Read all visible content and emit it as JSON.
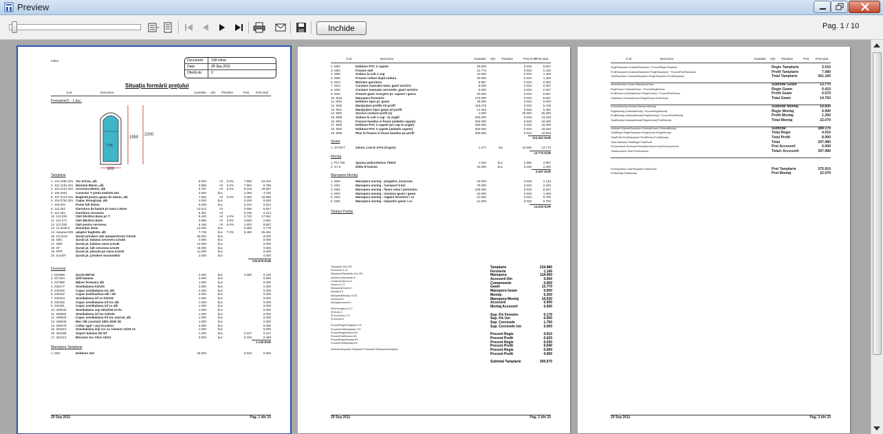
{
  "window": {
    "title": "Preview"
  },
  "toolbar": {
    "include_label": "Inchide",
    "page_indicator": "Pag. 1 / 10",
    "zoom_level": 0.03
  },
  "page1": {
    "user": "mihai",
    "info": {
      "doc_label": "Document:",
      "doc_value": "158 mihai",
      "date_label": "Data:",
      "date_value": "28 Sep 2011",
      "ofer_label": "Ofertă de:",
      "ofer_value": "0"
    },
    "title": "Situația formării prețului",
    "headers": {
      "cod": "Cod",
      "den": "Denumire",
      "cant": "Cantitate",
      "um": "UM",
      "pierd": "Pierdere",
      "pret": "Preț",
      "total": "Preț total"
    },
    "product": "Fereastra01 - 1 buc.",
    "drawing": {
      "w": "900",
      "h_out": "2200",
      "h_in": "1950",
      "label": "7.06"
    },
    "sec_templates": "Tamplarie",
    "templates": [
      [
        "1. 101.2081.001",
        "Toc 67mm, alb",
        "6.930",
        "ml",
        "6.0%",
        "7.850",
        "54.404"
      ],
      [
        "2. 101.2181.001",
        "Montant 85mm, alb",
        "0.855",
        "ml",
        "5.0%",
        "7.950",
        "6.795"
      ],
      [
        "3. 103.2121.001",
        "Cercevea 80mm, alb",
        "5.797",
        "ml",
        "6.0%",
        "8.100",
        "46.957"
      ],
      [
        "4. 106.2001",
        "Conector T pt102.218/102.241",
        "2.000",
        "buc",
        "",
        "2.050",
        "4.100"
      ],
      [
        "5. 107.2141.001",
        "Baghetă pentru geam de 24mm, alb",
        "7.593",
        "ml",
        "5.0%",
        "2.050",
        "15.566"
      ],
      [
        "6. 109.0761.001",
        "Capac drenaj/cap, alb",
        "4.000",
        "buc",
        "",
        "0.150",
        "0.600"
      ],
      [
        "7. 109.201",
        "Punte falt 32mm",
        "6.000",
        "buc",
        "",
        "0.104",
        "0.624"
      ],
      [
        "8. 112.253",
        "Garnitura de batant pt rama 2.5mm",
        "12.612",
        "ml",
        "",
        "0.550",
        "6.937"
      ],
      [
        "9. 112.254",
        "Garnitura cercevea",
        "5.381",
        "ml",
        "",
        "0.430",
        "2.314"
      ],
      [
        "10. 113.025",
        "Oțel 30x30x1.5mm pt. T",
        "6.420",
        "ml",
        "5.0%",
        "2.740",
        "17.591"
      ],
      [
        "11. 113.271",
        "Oțel 38x30x1.5mm",
        "0.855",
        "ml",
        "5.0%",
        "3.500",
        "2.991"
      ],
      [
        "12. 113.292",
        "Oțel pentru cercevea",
        "5.188",
        "ml",
        "5.0%",
        "1.900",
        "9.857"
      ],
      [
        "13. 14.2026.5",
        "Distanțier 5mm",
        "12.000",
        "buc",
        "",
        "0.065",
        "0.779"
      ],
      [
        "14. zaaaaaA001",
        "adaptor baghetă, alb",
        "7.738",
        "buc",
        "7.0%",
        "8.460",
        "65.461"
      ],
      [
        "15. S3.9x16",
        "Șurub prindere oțel autoperforant 3.9x16",
        "28.000",
        "buc",
        "",
        "",
        "0.000"
      ],
      [
        "16. SBC",
        "Șurub pt. balama cercevea 4.0x45",
        "4.000",
        "buc",
        "",
        "",
        "0.000"
      ],
      [
        "17. SBR",
        "Șurub pt. balama rama 4.0x45",
        "12.000",
        "buc",
        "",
        "",
        "0.000"
      ],
      [
        "18. SF",
        "Șurub pt. falt cercevea 4.0x25",
        "18.000",
        "buc",
        "",
        "",
        "0.000"
      ],
      [
        "19. SPR",
        "Șurub pt. placuta pe rama 4.0x25",
        "11.000",
        "buc",
        "",
        "",
        "0.000"
      ],
      [
        "20. SurubT",
        "Șurub pt. prindere montantilor",
        "2.000",
        "buc",
        "",
        "",
        "0.000"
      ]
    ],
    "templates_total": "234.976 EUR",
    "sec_feronerie": "Feronerie",
    "feronerie": [
      [
        "1. 002988",
        "Șurub M5*45",
        "2.000",
        "buc",
        "",
        "0.080",
        "0.160"
      ],
      [
        "2. 227364",
        "Știft balama",
        "2.000",
        "buc",
        "",
        "",
        "0.000"
      ],
      [
        "3. 227888",
        "Mâner fereastra alb",
        "1.000",
        "buc",
        "",
        "",
        "0.000"
      ],
      [
        "4. 230177",
        "Semibalama K3/100",
        "2.000",
        "buc",
        "",
        "",
        "0.000"
      ],
      [
        "5. 230205",
        "Capac semibalama toc alb",
        "2.000",
        "buc",
        "",
        "",
        "0.000"
      ],
      [
        "6. 230252",
        "Capac bratfoarfeca alb / SD",
        "2.000",
        "buc",
        "",
        "",
        "0.000"
      ],
      [
        "7. 230343",
        "Semibalama inf cv K3/100",
        "1.000",
        "buc",
        "",
        "",
        "0.000"
      ],
      [
        "8. 230426",
        "Capac semibalama inf toc alb",
        "1.000",
        "buc",
        "",
        "",
        "0.000"
      ],
      [
        "9. 230491",
        "Capac semibalama inf cv alb",
        "1.000",
        "buc",
        "",
        "",
        "0.000"
      ],
      [
        "10. 230640",
        "Semibalama sup SD12/20-13 Dr.",
        "1.000",
        "buc",
        "",
        "",
        "0.000"
      ],
      [
        "11. 258590",
        "Semibalama inf toc K3/100",
        "1.000",
        "buc",
        "",
        "",
        "0.000"
      ],
      [
        "12. 258926",
        "Capac semibalama inf toc marcat, alb",
        "1.000",
        "buc",
        "",
        "",
        "0.000"
      ],
      [
        "13. 259849",
        "Mec OB constant 1801-2000 2E",
        "1.000",
        "buc",
        "",
        "",
        "0.000"
      ],
      [
        "14. 260275",
        "Colțar cgal + pat incuietor",
        "2.000",
        "buc",
        "",
        "",
        "0.000"
      ],
      [
        "15. 264015",
        "Semibalama mijl cor cu rulment 12/20-13",
        "1.000",
        "buc",
        "",
        "",
        "0.000"
      ],
      [
        "16. 331488",
        "Suport balama SD NT",
        "1.000",
        "buc",
        "",
        "0.317",
        "0.317"
      ],
      [
        "17. 352213",
        "Blocator toc Vdcn AD13",
        "3.000",
        "buc",
        "",
        "0.156",
        "0.468"
      ]
    ],
    "feronerie_total": "1.145 EUR",
    "sec_manopera": "Manopera Tamplarie",
    "manopera": [
      [
        "1. M01",
        "Debitare otel",
        "18.000",
        "",
        "",
        "0.033",
        "0.600"
      ]
    ],
    "footer_date": "29 Sep 2011",
    "footer_page": "Pag. 1 din 10"
  },
  "page2": {
    "headers": {
      "cod": "Cod",
      "den": "Denumire",
      "cant": "Cantitate",
      "um": "UM",
      "pierd": "Pierdere",
      "pret": "Preț EUR",
      "total": "Preț total"
    },
    "manopera": [
      [
        "2. M03",
        "Debitare PVC 2 capete",
        "20.000",
        "",
        "",
        "0.033",
        "0.667"
      ],
      [
        "3. M04",
        "Frezare otel",
        "12.773",
        "",
        "",
        "0.033",
        "0.426"
      ],
      [
        "4. M05",
        "Sudura la colt 1 cap",
        "42.000",
        "",
        "",
        "0.033",
        "1.400"
      ],
      [
        "5. M09",
        "Frezare colturi după sudura",
        "40.000",
        "",
        "",
        "0.033",
        "1.333"
      ],
      [
        "6. M13",
        "Montare garnitura",
        "8.997",
        "",
        "",
        "0.033",
        "0.300"
      ],
      [
        "7. M14",
        "Curatare manuala rame, gauri aerisire",
        "8.000",
        "",
        "",
        "0.033",
        "0.267"
      ],
      [
        "8. M15",
        "Curatare manuala cercevele, gauri aerisire",
        "8.000",
        "",
        "",
        "0.033",
        "0.267"
      ],
      [
        "9. M16",
        "Frezare gauri scurgere pt. capace / gaura",
        "20.000",
        "",
        "",
        "0.033",
        "0.667"
      ],
      [
        "10. M18",
        "Manopera feronerie",
        "170.000",
        "",
        "",
        "0.033",
        "5.667"
      ],
      [
        "11. M19",
        "Debitare sipci pt. geam",
        "18.000",
        "",
        "",
        "0.033",
        "0.600"
      ],
      [
        "12. M30",
        "Manipulare profile ml profil",
        "153.278",
        "",
        "",
        "0.033",
        "5.109"
      ],
      [
        "13. M31",
        "Manipulare sipci geam ml profil",
        "14.463",
        "",
        "",
        "0.033",
        "0.482"
      ],
      [
        "14. M50",
        "Servicii curbare profil (1)",
        "1.000",
        "",
        "",
        "25.000",
        "25.000"
      ],
      [
        "15. M89",
        "Sudura la colt 1 cap - la unghi",
        "400.000",
        "",
        "",
        "0.033",
        "13.333"
      ],
      [
        "16. M91",
        "Frezare bandou si fixare (ambele capete)",
        "450.000",
        "",
        "",
        "0.033",
        "15.000"
      ],
      [
        "17. M93",
        "Debitare PVC 2 capete (un cap la unghi)",
        "450.000",
        "",
        "",
        "0.033",
        "15.000"
      ],
      [
        "18. M94",
        "Debitare PVC 2 capete (ambele capete)",
        "550.000",
        "",
        "",
        "0.033",
        "18.333"
      ],
      [
        "19. M95",
        "Plus fa frezare si fixare bandou pe profil",
        "300.000",
        "",
        "",
        "0.033",
        "10.000"
      ]
    ],
    "manopera_total": "114.451 EUR",
    "sec_geam": "Geam",
    "geam": [
      [
        "1. GT0077",
        "24mm, Low-E 4+F4 (Argon)",
        "1.377",
        "mp",
        "",
        "10.000",
        "13.773"
      ]
    ],
    "geam_total": "13.773 EUR",
    "sec_montaj": "Montaj",
    "montaj": [
      [
        "1. PU-750",
        "Spuma poliuretanica 750ml",
        "1.033",
        "buc",
        "",
        "2.900",
        "2.997"
      ],
      [
        "2. S7.5",
        "Diblu 8*112mm",
        "10.000",
        "buc",
        "",
        "0.230",
        "2.300"
      ]
    ],
    "montaj_total": "5.297 EUR",
    "sec_man_montaj": "Manopera Montaj",
    "man_montaj": [
      [
        "1. M20",
        "Manopera montaj - pregatire, incarcare",
        "34.000",
        "",
        "",
        "0.033",
        "1.133"
      ],
      [
        "2. M21",
        "Manopera montaj - transport 5 km",
        "70.000",
        "",
        "",
        "0.033",
        "2.333"
      ],
      [
        "3. M22",
        "Manopera montaj - fixare rama / perimetru",
        "248.000",
        "",
        "",
        "0.033",
        "8.267"
      ],
      [
        "4. M23",
        "Manopera montaj - montare geam / geam",
        "42.000",
        "",
        "",
        "0.033",
        "1.400"
      ],
      [
        "5. M24",
        "Manopera montaj - reglare feronerie / cv",
        "21.000",
        "",
        "",
        "0.033",
        "0.700"
      ],
      [
        "6. M25",
        "Manopera montaj - impartire geam / cv",
        "21.000",
        "",
        "",
        "0.033",
        "0.700"
      ]
    ],
    "man_montaj_total": "14.533 EUR",
    "sec_totaluri": "Totaluri Poziție",
    "formulas": [
      "Tamplarie=234.976",
      "Feronerie=1.14",
      "ManoperaTamplarie=114.451",
      "AccDinComponente=0",
      "ComponenteLoc=0",
      "Geam=13.77",
      "ManoperaGeam=0",
      "Montaj=5.3",
      "ManoperaMontaj=14.53",
      "Accesorii=0",
      "MontajAccesorii=0",
      "SFixFereastra=0.17",
      "SFixUsi=0",
      "SCercevele=1.75",
      "SCercUsi=0",
      "ProcentRegieTamplarie=1%",
      "ProcentProfitTamplarie=2%",
      "ProcentRegieGeam=3%",
      "ProcentProfitGeam=4%",
      "ProcentRegieMontaj=5%",
      "ProcentProfitMontaj=6%",
      "SubtotalTamplarie=Tamplarie+Feronerie+ManoperaTamplarie"
    ],
    "summary_group1": [
      [
        "Tamplarie",
        "234.980"
      ],
      [
        "Feronerie",
        "1.140"
      ],
      [
        "Manopera",
        "114.450"
      ],
      [
        "Accesorii Din",
        "0.000"
      ],
      [
        "Componente",
        "0.000"
      ],
      [
        "Geam",
        "13.770"
      ],
      [
        "Manopera Geam",
        "0.000"
      ],
      [
        "Montaj",
        "5.300"
      ],
      [
        "Manopera Montaj",
        "14.530"
      ],
      [
        "Accesorii",
        "0.000"
      ],
      [
        "Montaj Accesorii",
        "0.000"
      ]
    ],
    "summary_group2": [
      [
        "Sup. Fix Ferestre",
        "0.170"
      ],
      [
        "Sup. Fix Usi",
        "0.000"
      ],
      [
        "Sup. Cercevele",
        "1.750"
      ],
      [
        "Sup. Cercevele Usi",
        "0.000"
      ]
    ],
    "summary_group3": [
      [
        "Procent Regie",
        "0.010"
      ],
      [
        "Procent Profit",
        "0.020"
      ],
      [
        "Procent Regie",
        "0.030"
      ],
      [
        "Procent Profit",
        "0.040"
      ],
      [
        "Procent Regie",
        "0.050"
      ],
      [
        "Procent Profit",
        "0.060"
      ]
    ],
    "subtotal_tamplarie": [
      "Subtotal Tamplarie",
      "350.570"
    ],
    "footer_date": "29 Sep 2011",
    "footer_page": "Pag. 2 din 10"
  },
  "page3": {
    "headers": {
      "cod": "Cod",
      "den": "Denumire",
      "cant": "Cantitate",
      "um": "UM",
      "pierd": "Pierdere",
      "pret": "Preț",
      "total": "Preț total"
    },
    "rows": [
      [
        "RegieTamplarie=SubtotalTamplarie * ProcentRegieTamplarie",
        "Regie Tamplarie",
        "3.510",
        false
      ],
      [
        "ProfitTamplarie=(SubtotalTamplarie+RegieTamplarie) * ProcentProfitTamplarie",
        "Profit Tamplarie",
        "7.080",
        false
      ],
      [
        "TotalTamplarie=SubtotalTamplarie+RegieTamplarie+ProfitTamplarie",
        "Total Tamplarie",
        "361.160",
        true
      ],
      [
        "SubtotalGeam=Geam+ManoperaGeam",
        "Subtotal Geam",
        "13.770",
        false
      ],
      [
        "RegieGeam=SubtotalGeam * ProcentRegieGeam",
        "Regie Geam",
        "0.410",
        false
      ],
      [
        "ProfitGeam=(SubtotalGeam+RegieGeam) * ProcentProfitGeam",
        "Profit Geam",
        "0.570",
        false
      ],
      [
        "TotalGeam=SubtotalGeam+RegieGeam+ProfitGeam",
        "Total Geam",
        "14.750",
        true
      ],
      [
        "SubtotalMontaj=Montaj+ManoperaMontaj",
        "Subtotal Montaj",
        "19.830",
        false
      ],
      [
        "RegieMontaj=SubtotalMontaj * ProcentRegieMontaj",
        "Regie Montaj",
        "0.990",
        false
      ],
      [
        "ProfitMontaj=(SubtotalMontaj+RegieMontaj) * ProcentProfitMontaj",
        "Profit Montaj",
        "1.250",
        false
      ],
      [
        "TotalMontaj=SubtotalMontaj+RegieMontaj+ProfitMontaj",
        "Total Montaj",
        "22.070",
        true
      ],
      [
        "Subtotal=SubtotalTamplarie+SubtotalGeam+SubtotalMontaj",
        "Subtotal",
        "384.170",
        false
      ],
      [
        "TotalRegie=RegieTamplarie+RegieGeam+RegieMontaj",
        "Total Regie",
        "4.910",
        false
      ],
      [
        "TotalProfit=ProfitTamplarie+ProfitGeam+ProfitMontaj",
        "Total Profit",
        "8.900",
        false
      ],
      [
        "Total=Subtotal+TotalRegie+TotalProfit",
        "Total",
        "397.980",
        false
      ],
      [
        "PretAccesorii=Accesorii+MontajAccesorii+AccDinComponente",
        "Pret Accesorii",
        "0.000",
        false
      ],
      [
        "TotalAccesorii=Total+PretAccesorii",
        "Total+ Accesorii",
        "397.980",
        true
      ],
      [
        "PretTamplarie=TotalTamplarie+TotalGeam",
        "Pret Tamplarie",
        "375.910",
        false
      ],
      [
        "PretMontaj=TotalMontaj",
        "Pret Montaj",
        "22.070",
        false
      ]
    ],
    "footer_date": "29 Sep 2011",
    "footer_page": "Pag. 3 din 10"
  }
}
